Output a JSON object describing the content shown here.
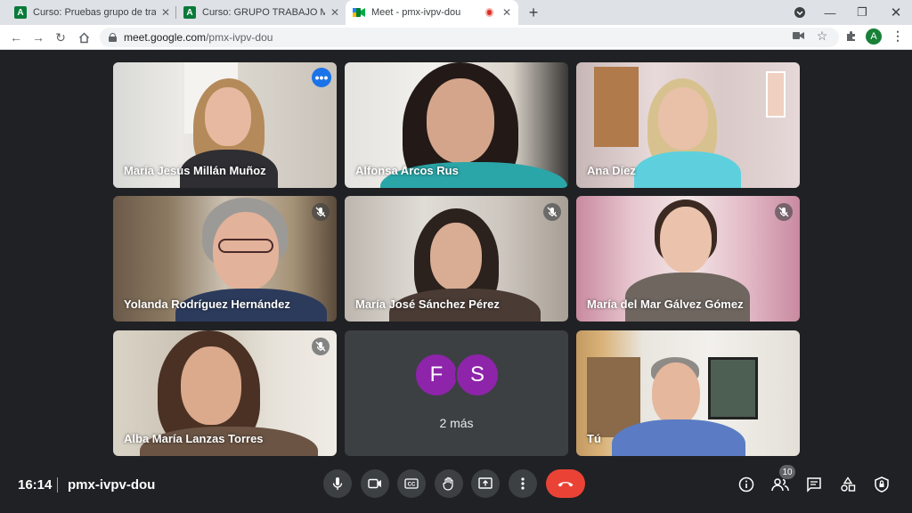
{
  "browser": {
    "tabs": [
      {
        "title": "Curso: Pruebas grupo de trabajo",
        "favicon": "moodle-icon"
      },
      {
        "title": "Curso: GRUPO TRABAJO MOODLE",
        "favicon": "moodle-icon"
      },
      {
        "title": "Meet - pmx-ivpv-dou",
        "favicon": "meet-icon",
        "active": true
      }
    ],
    "url_host": "meet.google.com",
    "url_path": "/pmx-ivpv-dou",
    "profile_initial": "A"
  },
  "meeting": {
    "participants": [
      {
        "name": "María Jesús Millán Muñoz",
        "muted": false,
        "active_speaker": true
      },
      {
        "name": "Alfonsa Arcos Rus",
        "muted": false
      },
      {
        "name": "Ana Díez",
        "muted": false
      },
      {
        "name": "Yolanda Rodríguez Hernández",
        "muted": true
      },
      {
        "name": "María José Sánchez Pérez",
        "muted": true
      },
      {
        "name": "María del Mar Gálvez Gómez",
        "muted": true
      },
      {
        "name": "Alba María Lanzas Torres",
        "muted": true
      },
      {
        "name": "Tú",
        "muted": false
      }
    ],
    "overflow": {
      "avatars": [
        "F",
        "S"
      ],
      "label": "2 más",
      "avatar_color": "#8e24aa"
    },
    "time": "16:14",
    "code": "pmx-ivpv-dou",
    "people_count": "10"
  },
  "colors": {
    "accent": "#8ab4f8",
    "hangup": "#ea4335",
    "control_bg": "#3c4043"
  }
}
